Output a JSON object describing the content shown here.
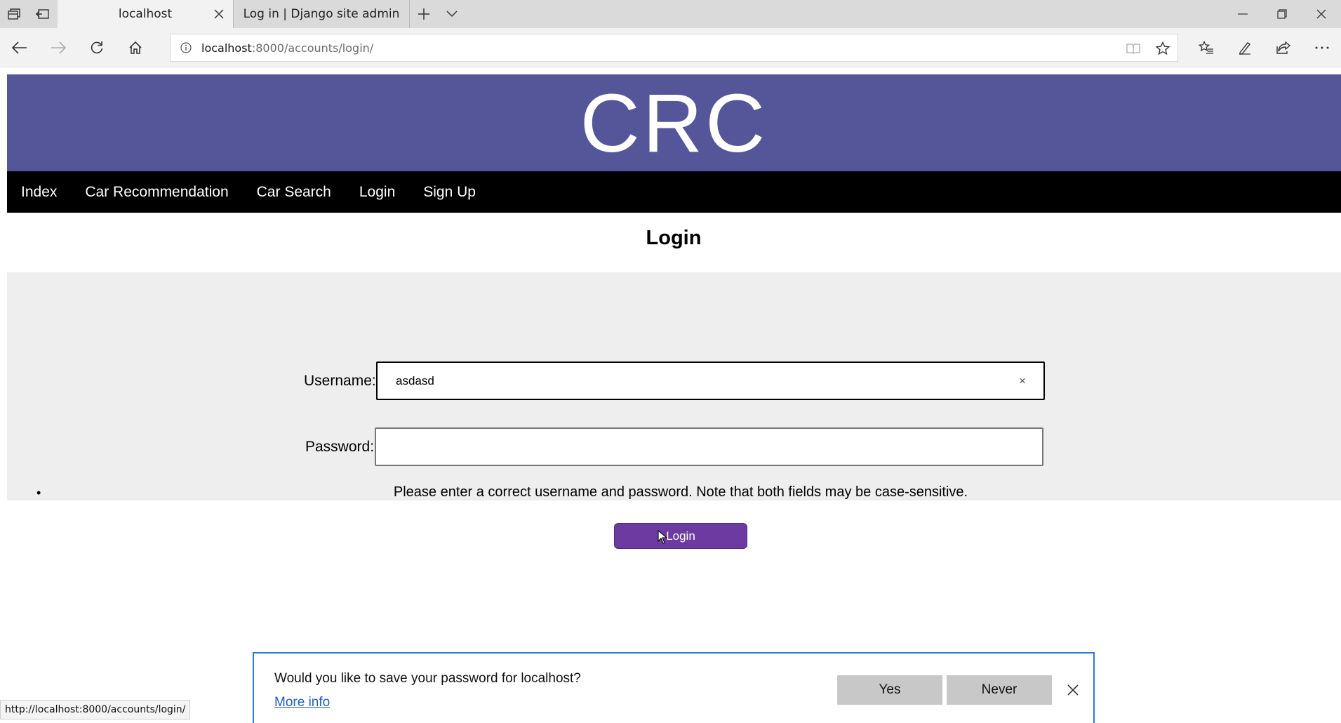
{
  "browser": {
    "tabs": [
      {
        "label": "localhost",
        "active": true
      },
      {
        "label": "Log in | Django site admin",
        "active": false
      }
    ],
    "url": {
      "host": "localhost",
      "rest": ":8000/accounts/login/"
    },
    "status_url": "http://localhost:8000/accounts/login/"
  },
  "site": {
    "title": "CRC",
    "menu": [
      "Index",
      "Car Recommendation",
      "Car Search",
      "Login",
      "Sign Up"
    ],
    "header_color": "#55559a"
  },
  "login": {
    "heading": "Login",
    "username_label": "Username:",
    "username_value": "asdasd",
    "clear_glyph": "×",
    "password_label": "Password:",
    "password_value": "",
    "bullet": "•",
    "error": "Please enter a correct username and password. Note that both fields may be case-sensitive.",
    "button_label": "Login",
    "button_color": "#6c3aa0"
  },
  "save_password_dialog": {
    "question": "Would you like to save your password for localhost?",
    "more_info": "More info",
    "yes_label": "Yes",
    "never_label": "Never",
    "accent": "#2a7acd"
  },
  "icons": [
    "tab-manager-icon",
    "set-aside-tabs-icon",
    "close-icon",
    "new-tab-icon",
    "tab-list-chevron-icon",
    "minimize-icon",
    "restore-icon",
    "window-close-icon",
    "back-icon",
    "forward-icon",
    "refresh-icon",
    "home-icon",
    "site-info-icon",
    "reading-view-icon",
    "favorite-star-icon",
    "favorites-hub-icon",
    "web-note-icon",
    "share-icon",
    "more-icon",
    "mouse-cursor-icon"
  ]
}
